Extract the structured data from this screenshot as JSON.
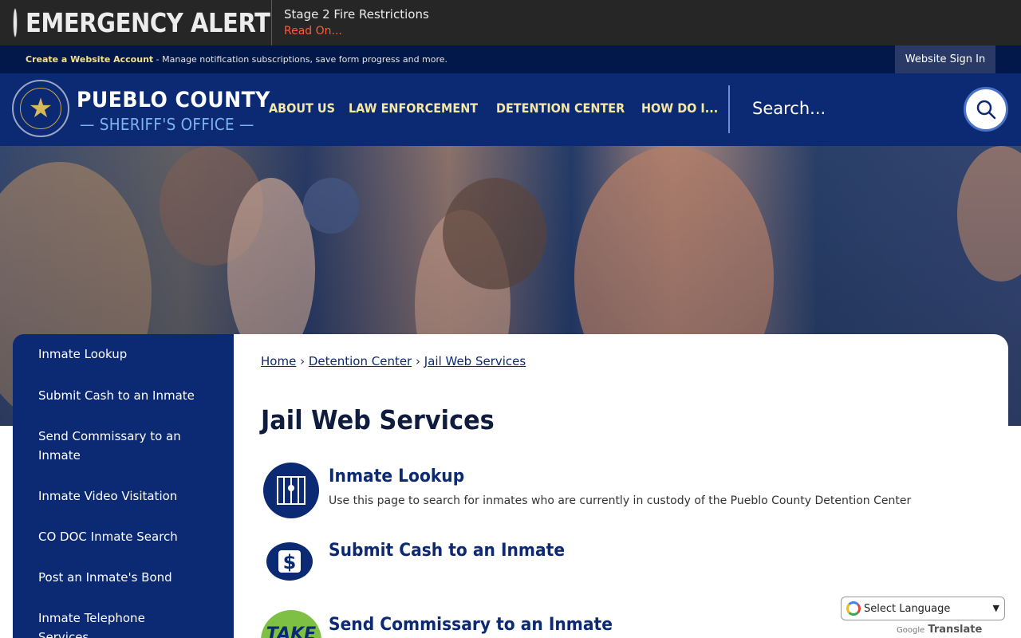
{
  "alert": {
    "title": "EMERGENCY ALERT",
    "message": "Stage 2 Fire Restrictions",
    "link": "Read On..."
  },
  "account": {
    "create_link": "Create a Website Account",
    "description": " - Manage notification subscriptions, save form progress and more.",
    "sign_in": "Website Sign In"
  },
  "header": {
    "brand_line1": "PUEBLO COUNTY",
    "brand_line2": "— SHERIFF'S OFFICE —",
    "nav": [
      "ABOUT US",
      "LAW ENFORCEMENT",
      "DETENTION CENTER",
      "HOW DO I..."
    ],
    "search_placeholder": "Search..."
  },
  "sidebar": {
    "items": [
      "Inmate Lookup",
      "Submit Cash to an Inmate",
      "Send Commissary to an Inmate",
      "Inmate Video Visitation",
      "CO DOC Inmate Search",
      "Post an Inmate's Bond",
      "Inmate Telephone Services"
    ]
  },
  "breadcrumb": {
    "home": "Home",
    "sep1": " › ",
    "section": "Detention Center",
    "sep2": " › ",
    "current": "Jail Web Services"
  },
  "main": {
    "title": "Jail Web Services",
    "services": [
      {
        "title": "Inmate Lookup",
        "description": "Use this page to search for inmates who are currently in custody of the Pueblo County Detention Center",
        "icon": "jail-bars-icon"
      },
      {
        "title": "Submit Cash to an Inmate",
        "description": "",
        "icon": "dollar-icon"
      },
      {
        "title": "Send Commissary to an Inmate",
        "description": "",
        "icon": "trinity-take-icon"
      }
    ]
  },
  "translate": {
    "select_label": "Select Language",
    "powered_google": "Google",
    "powered_translate": "Translate"
  },
  "colors": {
    "navy": "#0c2a73",
    "nav_text": "#f5e7a4",
    "alert_red": "#ff5a3c"
  }
}
